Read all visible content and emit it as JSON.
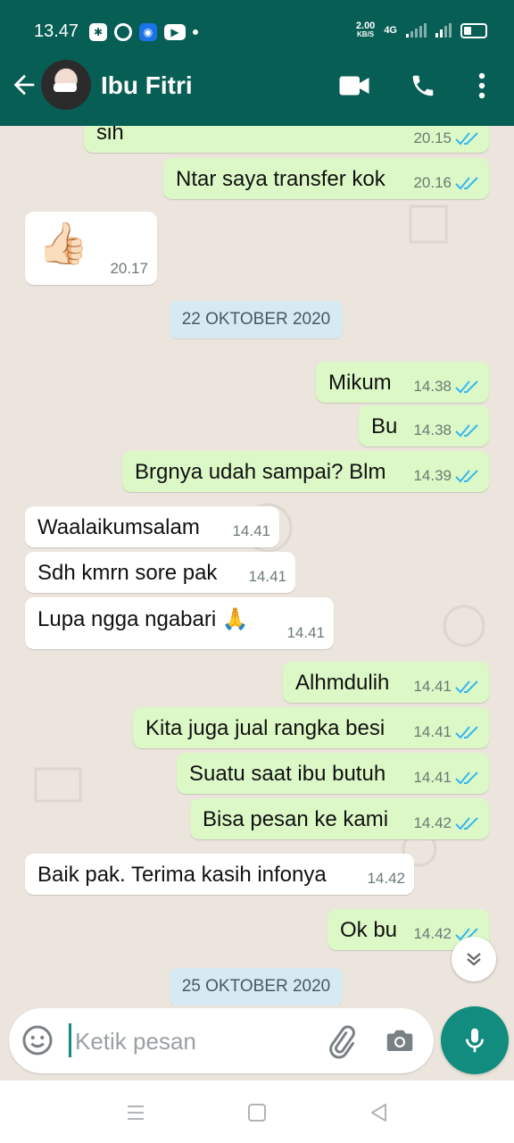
{
  "status_bar": {
    "time": "13.47",
    "speed_value": "2.00",
    "speed_unit": "KB/S",
    "network": "4G"
  },
  "header": {
    "contact_name": "Ibu Fitri"
  },
  "messages": [
    {
      "dir": "out",
      "text": "sih",
      "time": "20.15"
    },
    {
      "dir": "out",
      "text": "Ntar saya transfer kok",
      "time": "20.16"
    },
    {
      "dir": "in",
      "text": "👍🏻",
      "time": "20.17"
    },
    {
      "dir": "date",
      "text": "22 OKTOBER 2020"
    },
    {
      "dir": "out",
      "text": "Mikum",
      "time": "14.38"
    },
    {
      "dir": "out",
      "text": "Bu",
      "time": "14.38"
    },
    {
      "dir": "out",
      "text": "Brgnya udah sampai? Blm",
      "time": "14.39"
    },
    {
      "dir": "in",
      "text": "Waalaikumsalam",
      "time": "14.41"
    },
    {
      "dir": "in",
      "text": "Sdh kmrn sore pak",
      "time": "14.41"
    },
    {
      "dir": "in",
      "text": "Lupa ngga ngabari 🙏",
      "time": "14.41"
    },
    {
      "dir": "out",
      "text": "Alhmdulih",
      "time": "14.41"
    },
    {
      "dir": "out",
      "text": "Kita juga jual rangka besi",
      "time": "14.41"
    },
    {
      "dir": "out",
      "text": "Suatu saat ibu butuh",
      "time": "14.41"
    },
    {
      "dir": "out",
      "text": "Bisa pesan ke kami",
      "time": "14.42"
    },
    {
      "dir": "in",
      "text": "Baik pak. Terima kasih infonya",
      "time": "14.42"
    },
    {
      "dir": "out",
      "text": "Ok bu",
      "time": "14.42"
    },
    {
      "dir": "date",
      "text": "25 OKTOBER 2020"
    }
  ],
  "composer": {
    "placeholder": "Ketik pesan"
  },
  "icons": {
    "back": "arrow-left-icon",
    "video": "video-camera-icon",
    "call": "phone-icon",
    "menu": "more-vertical-icon",
    "emoji": "emoji-icon",
    "attach": "paperclip-icon",
    "camera": "camera-icon",
    "mic": "microphone-icon",
    "read": "double-check-icon",
    "scroll": "double-chevron-down-icon"
  },
  "colors": {
    "header": "#075E54",
    "outgoing": "#DCF8C6",
    "incoming": "#FFFFFF",
    "accent": "#128C7E",
    "read_ticks": "#34B7F1",
    "background": "#ECE5DD"
  }
}
